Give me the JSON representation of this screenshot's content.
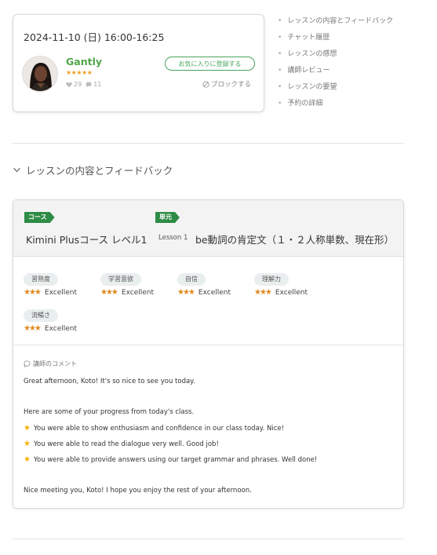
{
  "lesson": {
    "datetime": "2024-11-10 (日) 16:00-16:25",
    "teacher_name": "Gantly",
    "rating_stars": "★★★★★",
    "likes": "29",
    "comments": "11",
    "favorite_button": "お気に入りに登録する",
    "block_link": "ブロックする"
  },
  "toc": [
    {
      "label": "レッスンの内容とフィードバック"
    },
    {
      "label": "チャット履歴"
    },
    {
      "label": "レッスンの感想"
    },
    {
      "label": "講師レビュー"
    },
    {
      "label": "レッスンの要望"
    },
    {
      "label": "予約の詳細"
    }
  ],
  "section": {
    "title": "レッスンの内容とフィードバック"
  },
  "feedback": {
    "course_tag": "コース",
    "course_name": "Kimini Plusコース レベル1",
    "unit_tag": "単元",
    "lesson_number": "Lesson 1",
    "unit_name": "be動詞の肯定文（１・２人称単数、現在形）",
    "skills": [
      {
        "name": "習熟度",
        "stars": "★★★",
        "rating": "Excellent"
      },
      {
        "name": "学習意欲",
        "stars": "★★★",
        "rating": "Excellent"
      },
      {
        "name": "自信",
        "stars": "★★★",
        "rating": "Excellent"
      },
      {
        "name": "理解力",
        "stars": "★★★",
        "rating": "Excellent"
      },
      {
        "name": "流暢さ",
        "stars": "★★★",
        "rating": "Excellent"
      }
    ],
    "comment_label": "講師のコメント",
    "comment": {
      "greeting": "Great afternoon, Koto! It's so nice to see you today.",
      "intro": "Here are some of your progress from today's class.",
      "points": [
        "You were able to show enthusiasm and confidence in our class today. Nice!",
        "You were able to read the dialogue very well. Good job!",
        "You were able to provide answers using our target grammar and phrases. Well done!"
      ],
      "closing": "Nice meeting you, Koto! I hope you enjoy the rest of your afternoon."
    }
  },
  "colors": {
    "brand_green": "#2e8b45",
    "teacher_green": "#52a44a",
    "star_orange": "#e08a1e"
  }
}
